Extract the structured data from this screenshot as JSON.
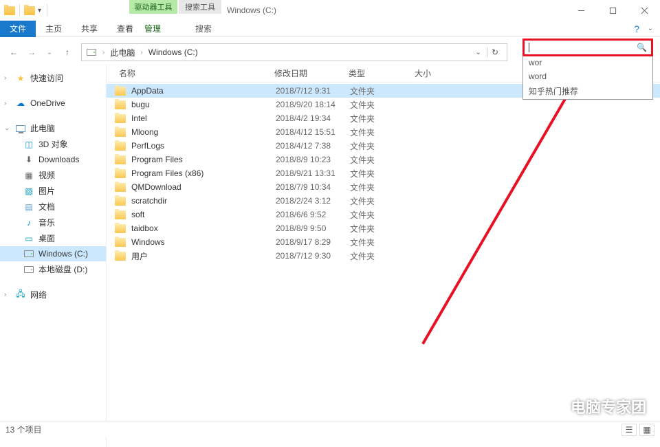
{
  "titlebar": {
    "title": "Windows (C:)"
  },
  "context_tabs": {
    "drive": "驱动器工具",
    "search": "搜索工具"
  },
  "ribbon": {
    "file": "文件",
    "tabs": [
      "主页",
      "共享",
      "查看"
    ],
    "drive_tab": "管理",
    "search_tab": "搜索"
  },
  "nav": {
    "breadcrumb_root": "此电脑",
    "breadcrumb_current": "Windows (C:)"
  },
  "search": {
    "placeholder": "",
    "suggestions": [
      "wor",
      "word",
      "知乎热门推荐"
    ]
  },
  "columns": {
    "name": "名称",
    "date": "修改日期",
    "type": "类型",
    "size": "大小"
  },
  "sidebar": {
    "quick": "快速访问",
    "onedrive": "OneDrive",
    "thispc": "此电脑",
    "pc_items": [
      "3D 对象",
      "Downloads",
      "视频",
      "图片",
      "文档",
      "音乐",
      "桌面",
      "Windows (C:)",
      "本地磁盘 (D:)"
    ],
    "network": "网络"
  },
  "files": [
    {
      "name": "AppData",
      "date": "2018/7/12 9:31",
      "type": "文件夹",
      "selected": true
    },
    {
      "name": "bugu",
      "date": "2018/9/20 18:14",
      "type": "文件夹"
    },
    {
      "name": "Intel",
      "date": "2018/4/2 19:34",
      "type": "文件夹"
    },
    {
      "name": "Mloong",
      "date": "2018/4/12 15:51",
      "type": "文件夹"
    },
    {
      "name": "PerfLogs",
      "date": "2018/4/12 7:38",
      "type": "文件夹"
    },
    {
      "name": "Program Files",
      "date": "2018/8/9 10:23",
      "type": "文件夹"
    },
    {
      "name": "Program Files (x86)",
      "date": "2018/9/21 13:31",
      "type": "文件夹"
    },
    {
      "name": "QMDownload",
      "date": "2018/7/9 10:34",
      "type": "文件夹"
    },
    {
      "name": "scratchdir",
      "date": "2018/2/24 3:12",
      "type": "文件夹"
    },
    {
      "name": "soft",
      "date": "2018/6/6 9:52",
      "type": "文件夹"
    },
    {
      "name": "taidbox",
      "date": "2018/8/9 9:50",
      "type": "文件夹"
    },
    {
      "name": "Windows",
      "date": "2018/9/17 8:29",
      "type": "文件夹"
    },
    {
      "name": "用户",
      "date": "2018/7/12 9:30",
      "type": "文件夹"
    }
  ],
  "status": {
    "count": "13 个项目"
  },
  "watermark": "电脑专家团"
}
